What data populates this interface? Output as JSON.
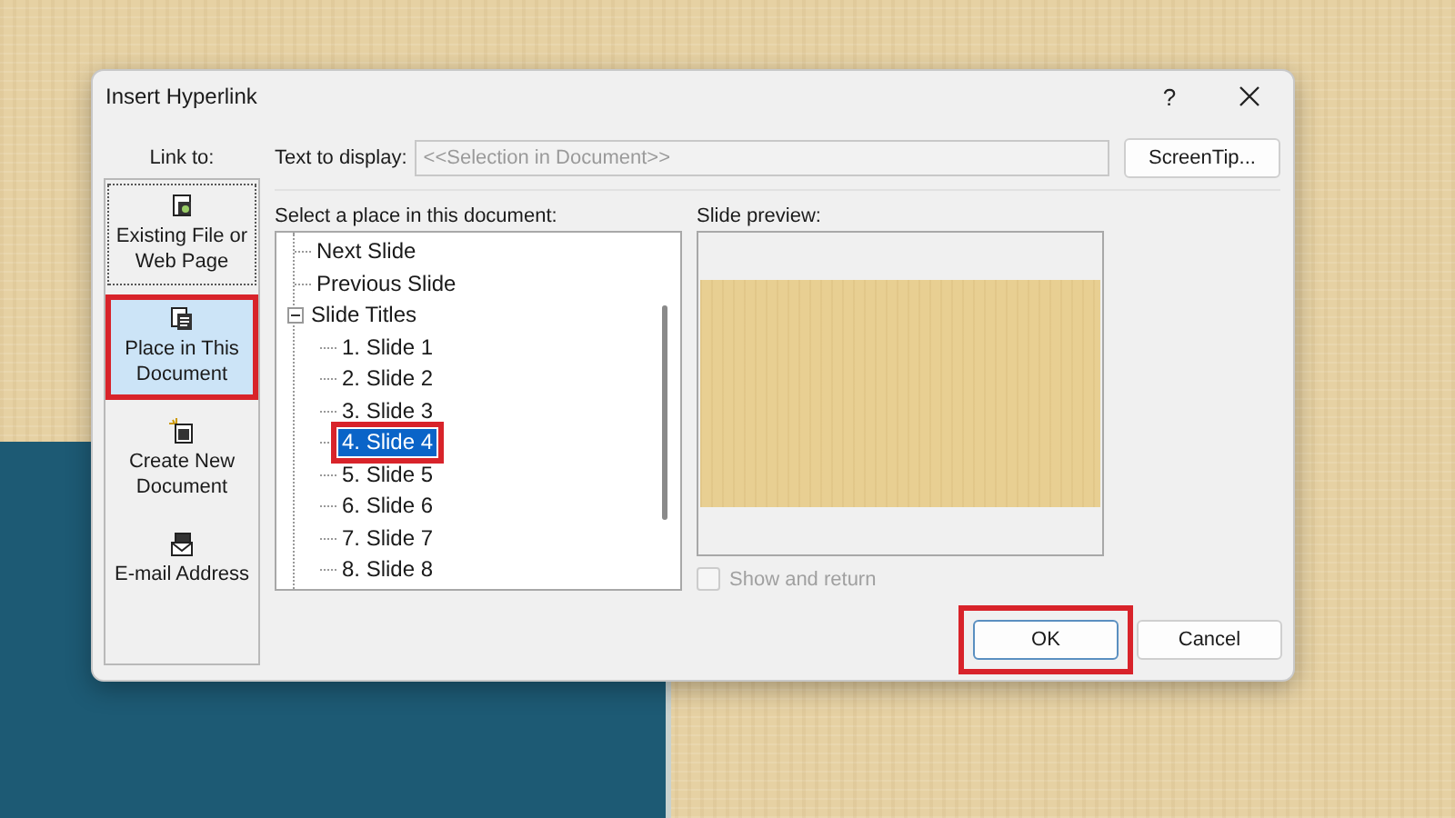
{
  "window": {
    "title": "Insert Hyperlink",
    "help": "?"
  },
  "link_to": {
    "label": "Link to:",
    "items": [
      {
        "kind": "file",
        "label": "Existing File or Web Page",
        "selected": false,
        "focused": true,
        "highlighted": false
      },
      {
        "kind": "place",
        "label": "Place in This Document",
        "selected": true,
        "focused": false,
        "highlighted": true
      },
      {
        "kind": "new",
        "label": "Create New Document",
        "selected": false,
        "focused": false,
        "highlighted": false
      },
      {
        "kind": "email",
        "label": "E-mail Address",
        "selected": false,
        "focused": false,
        "highlighted": false
      }
    ]
  },
  "text_to_display": {
    "label": "Text to display:",
    "value": "<<Selection in Document>>",
    "disabled": true
  },
  "screentip_button": {
    "label": "ScreenTip..."
  },
  "place_list": {
    "label": "Select a place in this document:",
    "items": [
      {
        "label": "Next Slide",
        "selected": false,
        "highlighted": false
      },
      {
        "label": "Previous Slide",
        "selected": false,
        "highlighted": false
      },
      {
        "label": "Slide Titles",
        "selected": false,
        "highlighted": false,
        "expanded": true,
        "children": [
          {
            "label": "1. Slide 1",
            "selected": false,
            "highlighted": false
          },
          {
            "label": "2. Slide 2",
            "selected": false,
            "highlighted": false
          },
          {
            "label": "3. Slide 3",
            "selected": false,
            "highlighted": false
          },
          {
            "label": "4. Slide 4",
            "selected": true,
            "highlighted": true
          },
          {
            "label": "5. Slide 5",
            "selected": false,
            "highlighted": false
          },
          {
            "label": "6. Slide 6",
            "selected": false,
            "highlighted": false
          },
          {
            "label": "7. Slide 7",
            "selected": false,
            "highlighted": false
          },
          {
            "label": "8. Slide 8",
            "selected": false,
            "highlighted": false
          }
        ]
      }
    ]
  },
  "preview": {
    "label": "Slide preview:"
  },
  "show_and_return": {
    "label": "Show and return",
    "checked": false,
    "disabled": true
  },
  "buttons": [
    {
      "label": "OK",
      "highlighted": true
    },
    {
      "label": "Cancel",
      "highlighted": false
    }
  ]
}
